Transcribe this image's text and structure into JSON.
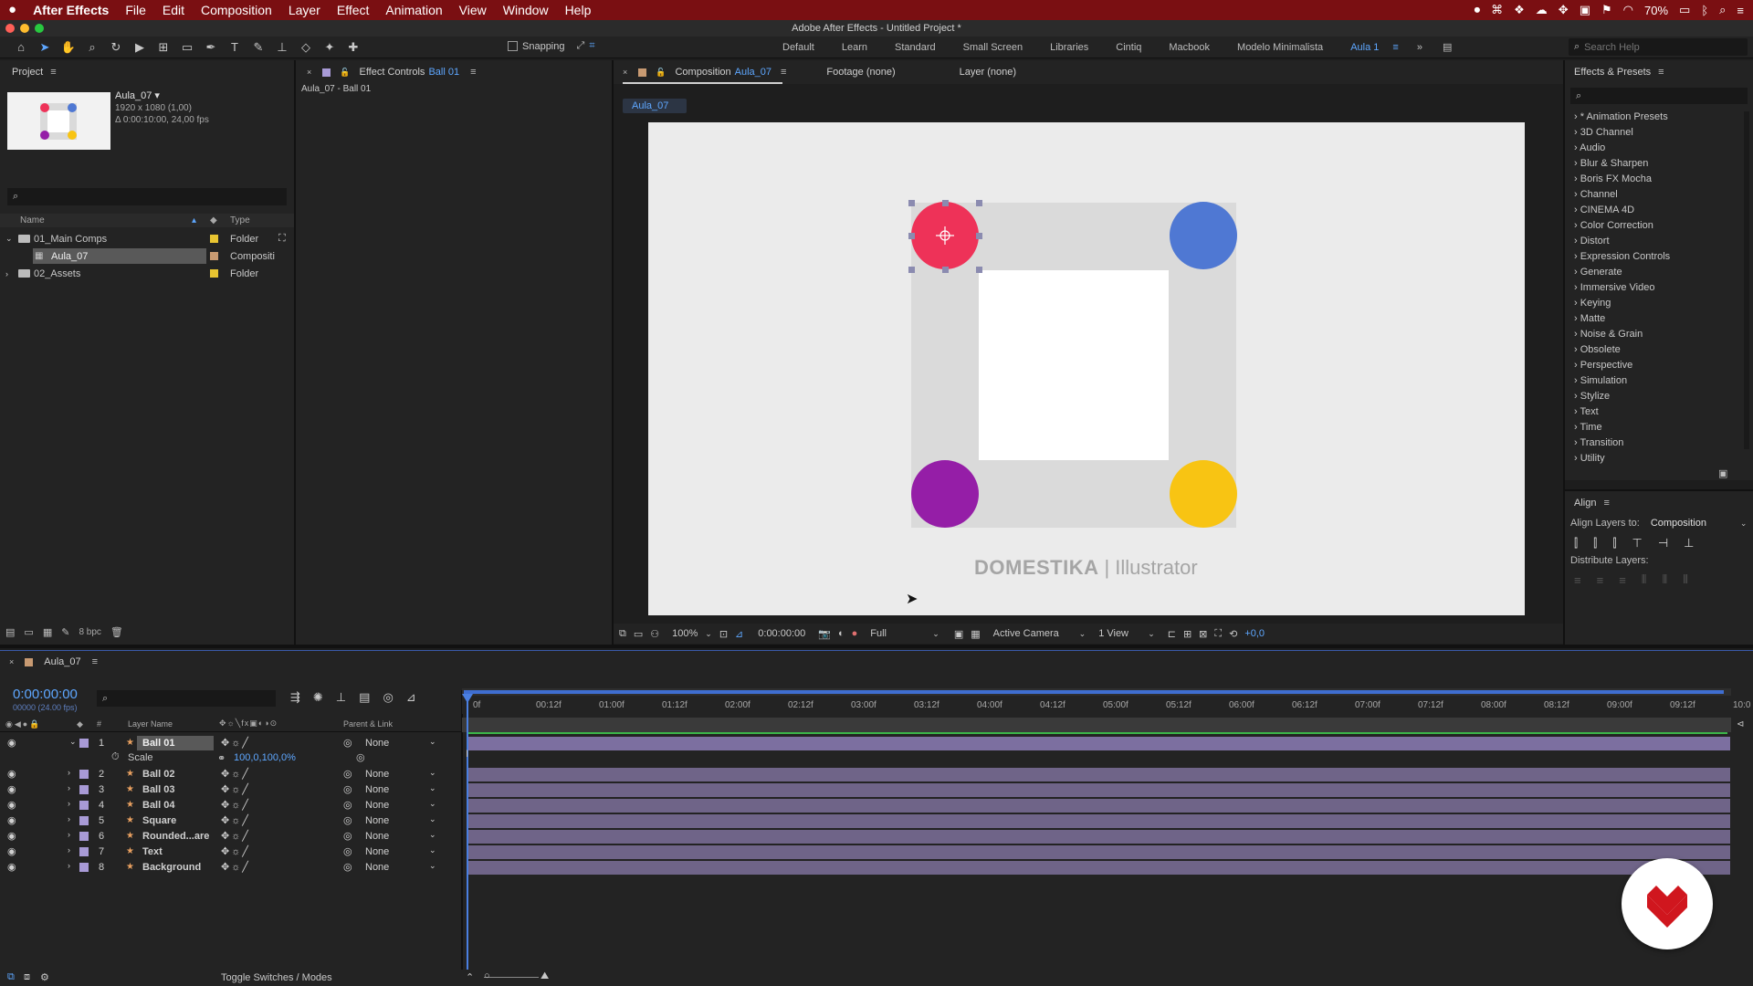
{
  "menubar": {
    "app_name": "After Effects",
    "items": [
      "File",
      "Edit",
      "Composition",
      "Layer",
      "Effect",
      "Animation",
      "View",
      "Window",
      "Help"
    ],
    "battery": "70%"
  },
  "window": {
    "title": "Adobe After Effects - Untitled Project *"
  },
  "toolbar": {
    "snapping_label": "Snapping",
    "workspaces": [
      "Default",
      "Learn",
      "Standard",
      "Small Screen",
      "Libraries",
      "Cintiq",
      "Macbook",
      "Modelo Minimalista",
      "Aula 1"
    ],
    "active_workspace": "Aula 1",
    "search_placeholder": "Search Help"
  },
  "project": {
    "tab_label": "Project",
    "comp_name": "Aula_07 ▾",
    "comp_size": "1920 x 1080 (1,00)",
    "comp_duration": "Δ 0:00:10:00, 24,00 fps",
    "col_name": "Name",
    "col_type": "Type",
    "rows": [
      {
        "name": "01_Main Comps",
        "type": "Folder"
      },
      {
        "name": "Aula_07",
        "type": "Compositi"
      },
      {
        "name": "02_Assets",
        "type": "Folder"
      }
    ],
    "bpc": "8 bpc"
  },
  "effect_controls": {
    "tab_prefix": "Effect Controls",
    "tab_layer": "Ball 01",
    "subtitle": "Aula_07 - Ball 01"
  },
  "composition": {
    "tab_prefix": "Composition",
    "tab_comp": "Aula_07",
    "footage_tab": "Footage (none)",
    "layer_tab": "Layer (none)",
    "breadcrumb": "Aula_07",
    "watermark_brand": "DOMESTIKA",
    "watermark_sep": "|",
    "watermark_product": "Illustrator",
    "zoom": "100%",
    "timecode": "0:00:00:00",
    "resolution": "Full",
    "camera": "Active Camera",
    "views": "1 View",
    "exposure": "+0,0",
    "colors": {
      "ball1": "#ee3258",
      "ball2": "#4f78d3",
      "ball3": "#951ea7",
      "ball4": "#f8c413",
      "square": "#dadada"
    }
  },
  "effects_presets": {
    "tab_label": "Effects & Presets",
    "items": [
      "* Animation Presets",
      "3D Channel",
      "Audio",
      "Blur & Sharpen",
      "Boris FX Mocha",
      "Channel",
      "CINEMA 4D",
      "Color Correction",
      "Distort",
      "Expression Controls",
      "Generate",
      "Immersive Video",
      "Keying",
      "Matte",
      "Noise & Grain",
      "Obsolete",
      "Perspective",
      "Simulation",
      "Stylize",
      "Text",
      "Time",
      "Transition",
      "Utility"
    ]
  },
  "align": {
    "tab_label": "Align",
    "align_to_label": "Align Layers to:",
    "align_to_value": "Composition",
    "distribute_label": "Distribute Layers:"
  },
  "timeline": {
    "tab_label": "Aula_07",
    "timecode": "0:00:00:00",
    "frame_info": "00000 (24.00 fps)",
    "col_num": "#",
    "col_layer_name": "Layer Name",
    "col_parent": "Parent & Link",
    "scale_label": "Scale",
    "scale_value": "100,0,100,0%",
    "layers": [
      {
        "num": "1",
        "name": "Ball 01",
        "parent": "None"
      },
      {
        "num": "2",
        "name": "Ball 02",
        "parent": "None"
      },
      {
        "num": "3",
        "name": "Ball 03",
        "parent": "None"
      },
      {
        "num": "4",
        "name": "Ball 04",
        "parent": "None"
      },
      {
        "num": "5",
        "name": "Square",
        "parent": "None"
      },
      {
        "num": "6",
        "name": "Rounded...are",
        "parent": "None"
      },
      {
        "num": "7",
        "name": "Text",
        "parent": "None"
      },
      {
        "num": "8",
        "name": "Background",
        "parent": "None"
      }
    ],
    "ruler": [
      "0f",
      "00:12f",
      "01:00f",
      "01:12f",
      "02:00f",
      "02:12f",
      "03:00f",
      "03:12f",
      "04:00f",
      "04:12f",
      "05:00f",
      "05:12f",
      "06:00f",
      "06:12f",
      "07:00f",
      "07:12f",
      "08:00f",
      "08:12f",
      "09:00f",
      "09:12f",
      "10:0"
    ],
    "toggle_label": "Toggle Switches / Modes"
  }
}
